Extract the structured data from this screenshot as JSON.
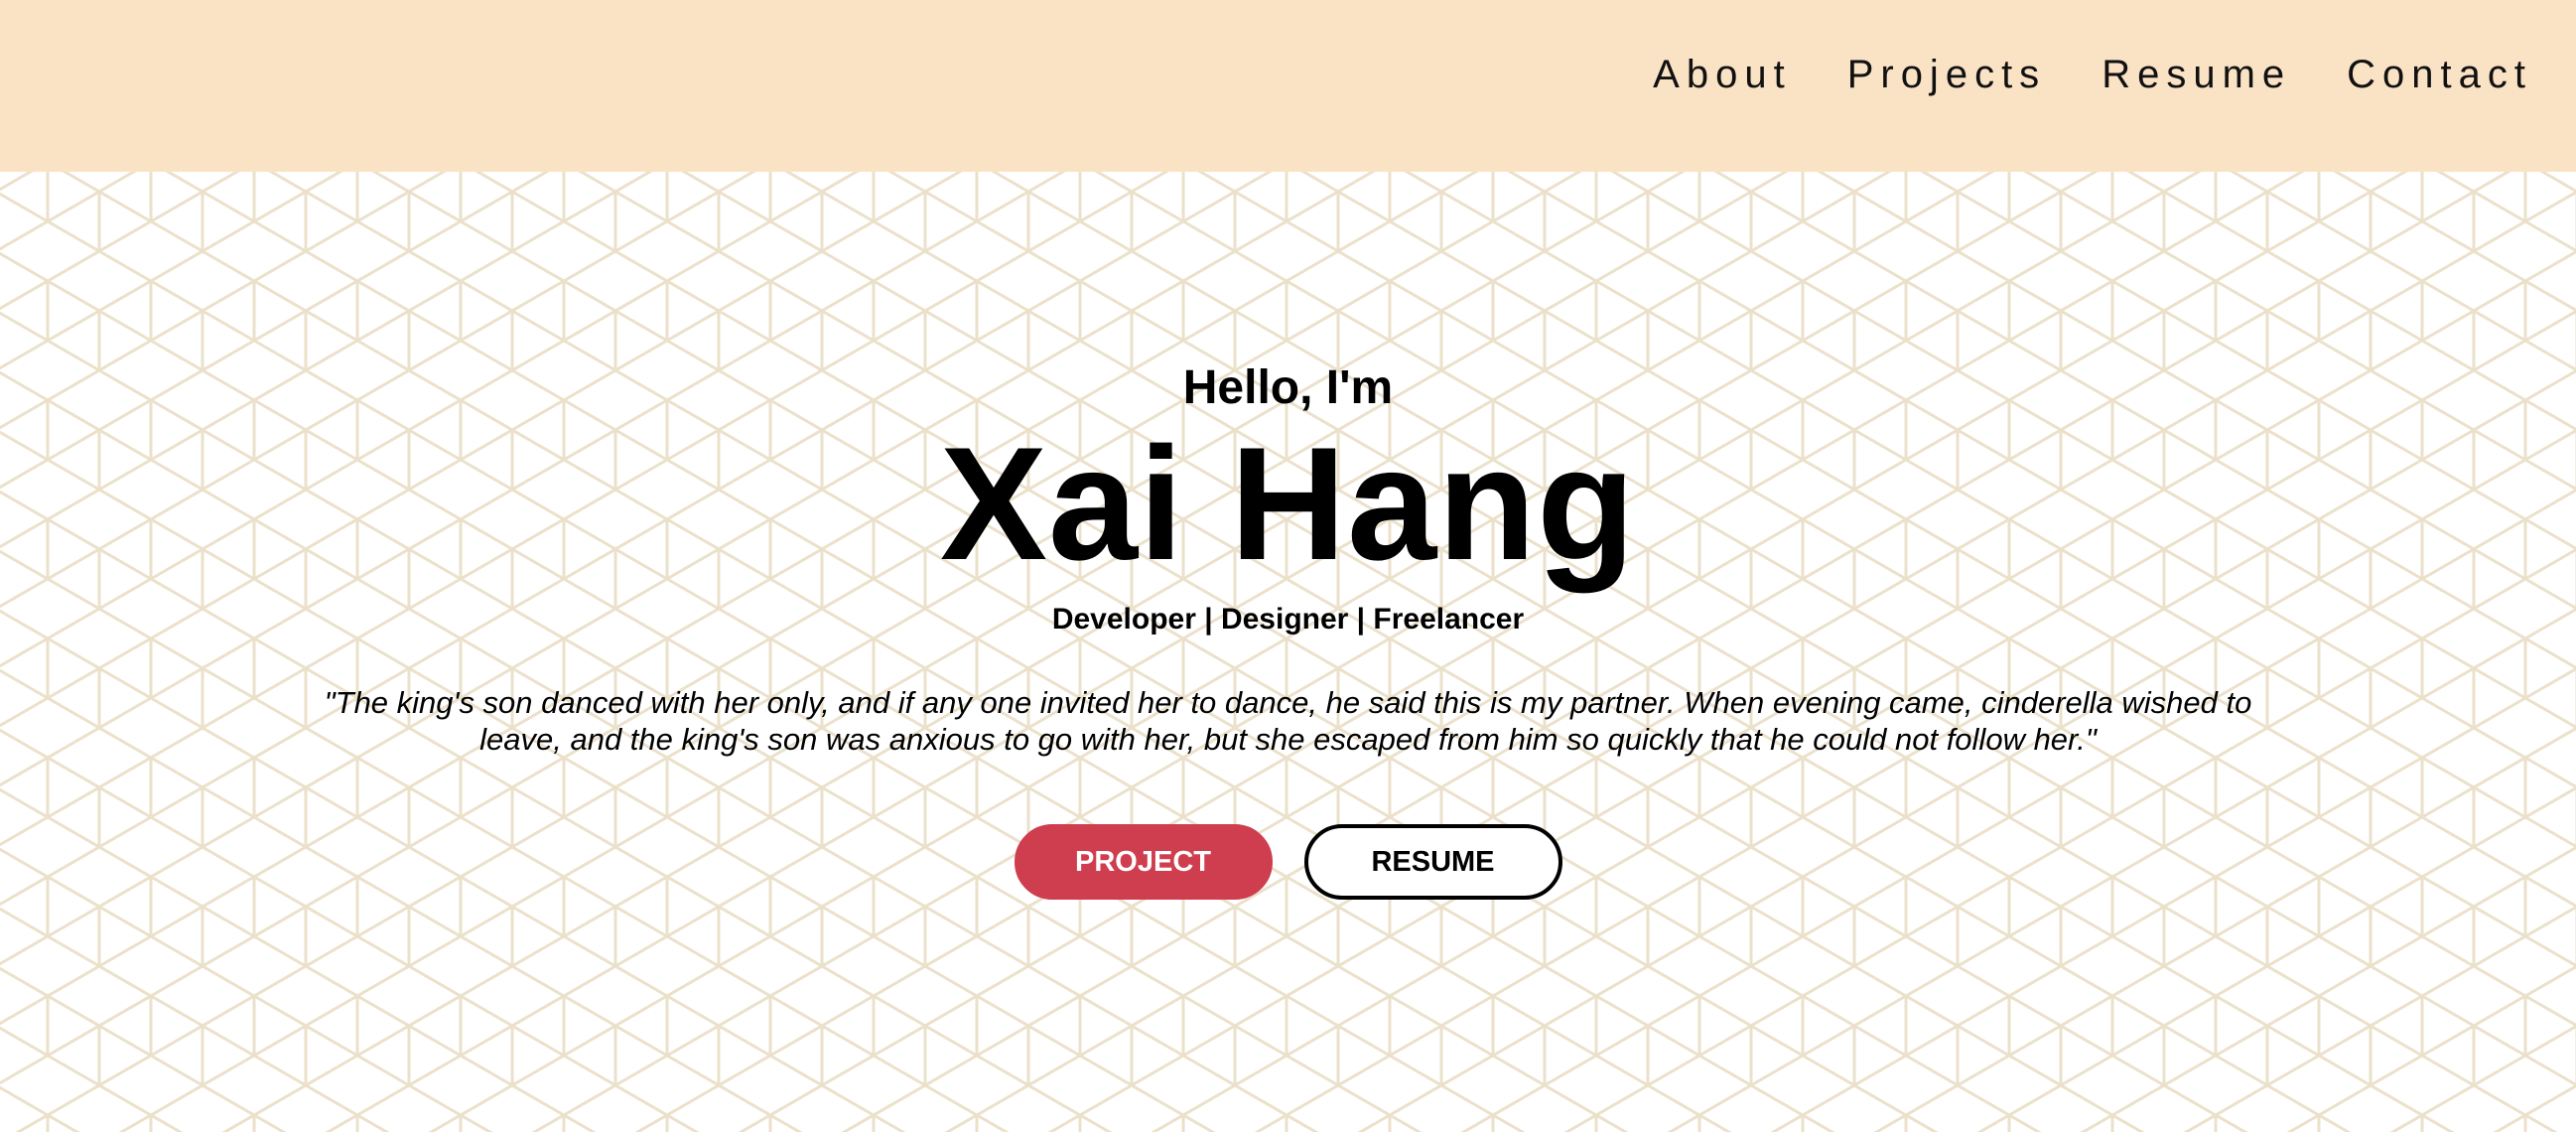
{
  "nav": {
    "items": [
      {
        "label": "About"
      },
      {
        "label": "Projects"
      },
      {
        "label": "Resume"
      },
      {
        "label": "Contact"
      }
    ]
  },
  "hero": {
    "greeting": "Hello, I'm",
    "name": "Xai Hang",
    "roles": "Developer | Designer | Freelancer",
    "quote_line_1": "\"The king's son danced with her only, and if any one invited her to dance, he said this is my partner. When evening came, cinderella wished to",
    "quote_line_2": "leave, and the king's son was anxious to go with her, but she escaped from him so quickly that he could not follow her.\"",
    "buttons": {
      "primary": "PROJECT",
      "secondary": "RESUME"
    }
  },
  "colors": {
    "header_bg": "#fae3c5",
    "accent": "#cf3e4f",
    "pattern_line": "#e8dcc2",
    "text": "#000000"
  }
}
